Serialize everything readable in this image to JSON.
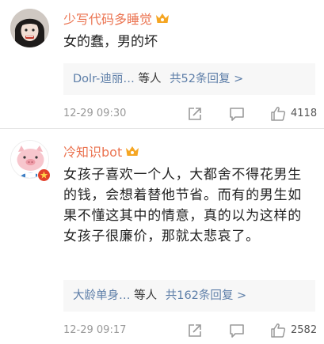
{
  "comments": [
    {
      "username": "少写代码多睡觉",
      "text": "女的蠢，男的坏",
      "reply_names": "Dolr-迪丽…",
      "reply_etc": "等人",
      "reply_count": "共52条回复 >",
      "time": "12-29 09:30",
      "likes": "4118"
    },
    {
      "username": "冷知识bot",
      "text": "女孩子喜欢一个人，大都舍不得花男生的钱，会想着替他节省。而有的男生如果不懂这其中的情意，真的以为这样的女孩子很廉价，那就太悲哀了。",
      "reply_names": "大龄单身…",
      "reply_etc": "等人",
      "reply_count": "共162条回复 >",
      "time": "12-29 09:17",
      "likes": "2582"
    }
  ],
  "colors": {
    "username": "#eb7350",
    "link": "#5d7ea8",
    "crown": "#f5a623"
  }
}
